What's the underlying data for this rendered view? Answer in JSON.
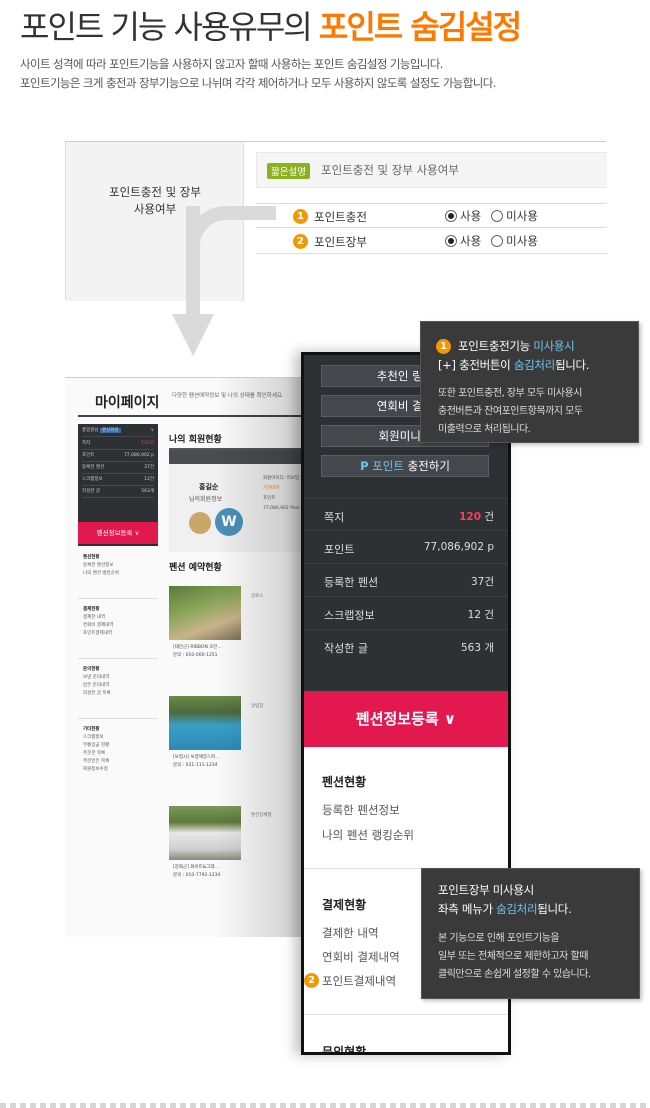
{
  "header": {
    "title_prefix": "포인트 기능 사용유무의 ",
    "title_highlight": "포인트 숨김설정",
    "desc_line1": "사이트 성격에 따라 포인트기능을 사용하지 않고자 할때 사용하는 포인트 숨김설정 기능입니다.",
    "desc_line2": "포인트기능은 크게 충전과 장부기능으로 나뉘며 각각 제어하거나 모두 사용하지 않도록 설정도 가능합니다."
  },
  "settings": {
    "label_line1": "포인트충전 및 장부",
    "label_line2": "사용여부",
    "hint_badge": "짧은설명",
    "hint_text": "포인트충전 및 장부 사용여부",
    "rows": [
      {
        "num": "1",
        "label": "포인트충전",
        "opt_use": "사용",
        "opt_nouse": "미사용"
      },
      {
        "num": "2",
        "label": "포인트장부",
        "opt_use": "사용",
        "opt_nouse": "미사용"
      }
    ]
  },
  "mypage": {
    "title": "마이페이지",
    "subtitle": "다양한 펜션예약정보 및 나의 상태를 확인하세요.",
    "side_top": "총입원님 ",
    "side_badge": "펜션회원",
    "side_rows": [
      {
        "k": "쪽지",
        "v": "120건"
      },
      {
        "k": "포인트",
        "v": "77,086,902 p"
      },
      {
        "k": "등록한 펜션",
        "v": "37건"
      },
      {
        "k": "스크랩정보",
        "v": "12건"
      },
      {
        "k": "작성한 글",
        "v": "563개"
      }
    ],
    "pink_btn": "펜션정보등록 ∨",
    "menus": [
      {
        "h": "펜션현황",
        "items": [
          "등록한 펜션정보",
          "나의 펜션 랭킹순위"
        ]
      },
      {
        "h": "결제현황",
        "items": [
          "결제한 내역",
          "연회비 결제내역",
          "포인트결제내역"
        ]
      },
      {
        "h": "문의현황",
        "items": [
          "보낸 문의내역",
          "받은 문의내역",
          "작성한 글 목록"
        ]
      },
      {
        "h": "기타현황",
        "items": [
          "스크랩정보",
          "무통입금 현황",
          "주문한 목록",
          "주문받은 목록",
          "회원정보수정"
        ]
      }
    ],
    "member_section": "나의 회원현황",
    "member_name": "홍길순",
    "member_role": "님의회원정보",
    "member_info": [
      "회원아이디: 미보임",
      "가가마마",
      "포인트",
      "77,086,902 Poin"
    ],
    "booking_section": "펜션 예약현황",
    "captions": [
      {
        "line1": "[태안군] RIBBON 모던...",
        "line2": "문의 : 010-000-1251"
      },
      {
        "line1": "[보령시] 보령해양스파...",
        "line2": "문의 : 031-111-1234"
      },
      {
        "line1": "[강화군] 화이트&그레...",
        "line2": "문의 : 010-7792-1234"
      }
    ],
    "col2": [
      "글로스",
      "알림장",
      "펜션장체험"
    ]
  },
  "zoom": {
    "btn_recommend": "추천인 링크",
    "btn_annual": "연회비 결제",
    "btn_homepage": "회원미니홈",
    "btn_charge_p": "P",
    "btn_charge_point": "포인트",
    "btn_charge_rest": " 충전하기",
    "stats": [
      {
        "k": "쪽지",
        "v_red": "120",
        "v": " 건"
      },
      {
        "k": "포인트",
        "v_red": "",
        "v": "77,086,902 p"
      },
      {
        "k": "등록한 펜션",
        "v_red": "",
        "v": "37건"
      },
      {
        "k": "스크랩정보",
        "v_red": "",
        "v": "12 건"
      },
      {
        "k": "작성한 글",
        "v_red": "",
        "v": "563 개"
      }
    ],
    "pink_btn": "펜션정보등록 ∨",
    "sec1_title": "펜션현황",
    "sec1_items": [
      "등록한 펜션정보",
      "나의 펜션 랭킹순위"
    ],
    "sec2_title": "결제현황",
    "sec2_items": [
      "결제한 내역",
      "연회비 결제내역",
      "포인트결제내역"
    ],
    "sec2_num": "2",
    "sec3_title": "문의현황"
  },
  "tip1": {
    "num": "1",
    "line1_a": "포인트충전기능 ",
    "line1_b": "미사용시",
    "line2_a": "[+] 충전버튼이 ",
    "line2_b": "숨김처리",
    "line2_c": "됩니다.",
    "sub1": "또한 포인트충전, 장부 모두 미사용시",
    "sub2": "충전버튼과 잔여포인트항목까지 모두",
    "sub3": "미출력으로 처리됩니다."
  },
  "tip2": {
    "line1": "포인트장부 미사용시",
    "line2_a": "좌측 메뉴가 ",
    "line2_b": "숨김처리",
    "line2_c": "됩니다.",
    "sub1": "본 기능으로 인해 포인트기능을",
    "sub2": "일부 또는 전체적으로 제한하고자 할때",
    "sub3": "클릭만으로 손쉽게 설정할 수 있습니다."
  },
  "colors": {
    "accent_orange": "#ff7800",
    "number_badge": "#f39800",
    "pink": "#e3184e",
    "dark_panel": "#2e3134",
    "highlight_blue": "#6cc7f0"
  }
}
